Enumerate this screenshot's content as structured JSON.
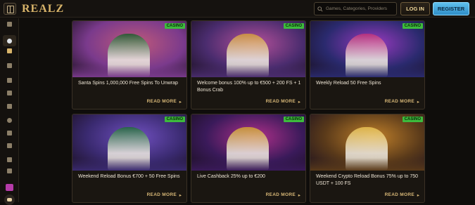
{
  "header": {
    "logo": "REALZ",
    "search_placeholder": "Games, Categories, Providers",
    "login_label": "LOG IN",
    "register_label": "REGISTER"
  },
  "sidebar": {
    "icons": [
      "home-icon",
      "drop-icon",
      "slots-icon",
      "tent-icon",
      "list-icon",
      "phone-icon",
      "flower-icon",
      "ball-icon",
      "ticket-icon",
      "coupon-icon",
      "trophy-icon",
      "building-icon",
      "gift-icon",
      "chat-icon"
    ]
  },
  "promotions": [
    {
      "badge": "CASINO",
      "title": "Santa Spins 1,000,000 Free Spins To Unwrap",
      "cta": "READ MORE",
      "arrow": "▸",
      "theme": [
        "#7a3a8c",
        "#c0597a",
        "#1c5a2a"
      ]
    },
    {
      "badge": "CASINO",
      "title": "Welcome bonus 100% up to €500 + 200 FS + 1 Bonus Crab",
      "cta": "READ MORE",
      "arrow": "▸",
      "theme": [
        "#4a2c6e",
        "#b4509a",
        "#d39a3a"
      ]
    },
    {
      "badge": "CASINO",
      "title": "Weekly Reload 50 Free Spins",
      "cta": "READ MORE",
      "arrow": "▸",
      "theme": [
        "#2a2a6e",
        "#9a3ac0",
        "#c0307a"
      ]
    },
    {
      "badge": "CASINO",
      "title": "Weekend Reload Bonus €700 + 50 Free Spins",
      "cta": "READ MORE",
      "arrow": "▸",
      "theme": [
        "#3a2a70",
        "#7050c0",
        "#1f6a3a"
      ]
    },
    {
      "badge": "CASINO",
      "title": "Live Cashback 25% up to €200",
      "cta": "READ MORE",
      "arrow": "▸",
      "theme": [
        "#3a1a5a",
        "#b0308a",
        "#d0a030"
      ]
    },
    {
      "badge": "CASINO",
      "title": "Weekend Crypto Reload Bonus 75% up to 750 USDT + 100 FS",
      "cta": "READ MORE",
      "arrow": "▸",
      "theme": [
        "#5a3a1a",
        "#c0802a",
        "#e8c050"
      ]
    }
  ]
}
